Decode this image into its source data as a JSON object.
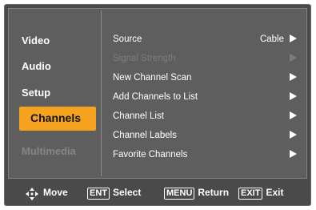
{
  "categories": [
    {
      "label": "Video",
      "state": "normal"
    },
    {
      "label": "Audio",
      "state": "normal"
    },
    {
      "label": "Setup",
      "state": "normal"
    },
    {
      "label": "Channels",
      "state": "selected"
    },
    {
      "label": "Multimedia",
      "state": "disabled"
    }
  ],
  "items": [
    {
      "label": "Source",
      "value": "Cable",
      "enabled": true
    },
    {
      "label": "Signal Strength",
      "value": "",
      "enabled": false
    },
    {
      "label": "New Channel Scan",
      "value": "",
      "enabled": true
    },
    {
      "label": "Add Channels to List",
      "value": "",
      "enabled": true
    },
    {
      "label": "Channel List",
      "value": "",
      "enabled": true
    },
    {
      "label": "Channel Labels",
      "value": "",
      "enabled": true
    },
    {
      "label": "Favorite Channels",
      "value": "",
      "enabled": true
    }
  ],
  "footer": {
    "move": {
      "icon": "move-arrows-icon",
      "label": "Move"
    },
    "select": {
      "key": "ENT",
      "label": "Select"
    },
    "return": {
      "key": "MENU",
      "label": "Return"
    },
    "exit": {
      "key": "EXIT",
      "label": "Exit"
    }
  },
  "colors": {
    "highlight": "#f5a31f",
    "background": "#4a4a4a",
    "panel": "#5e5e5e"
  }
}
